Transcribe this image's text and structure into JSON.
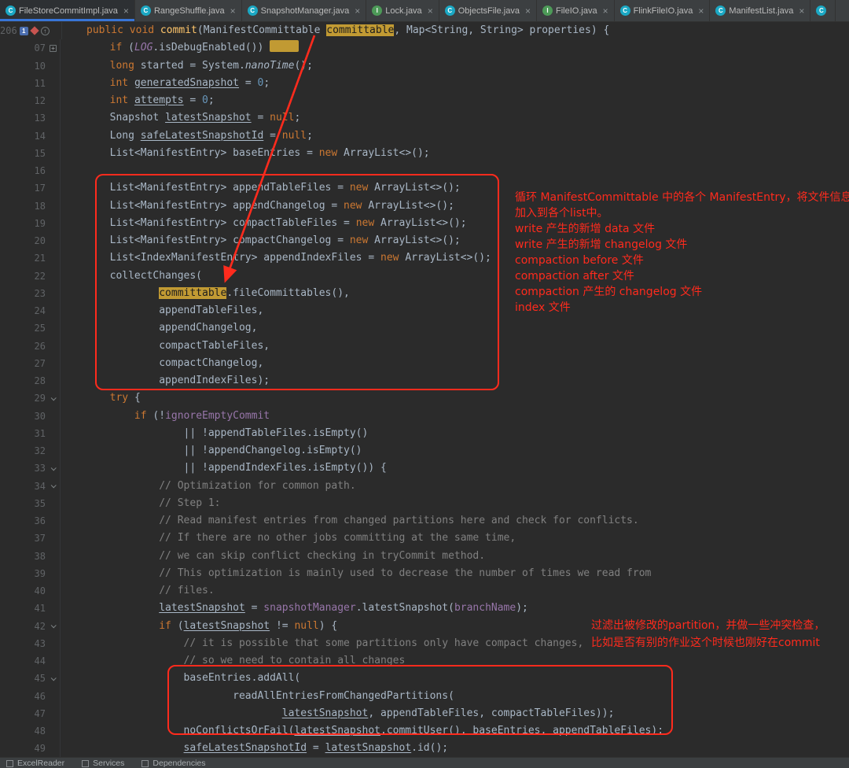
{
  "theme": {
    "bg": "#2b2b2b",
    "fg": "#a9b7c6",
    "kw": "#cc7832",
    "num": "#6897bb",
    "cmt": "#808080",
    "field": "#9876aa",
    "method": "#ffc66b",
    "gold": "#c19a33",
    "goldfg": "#1d1d1d",
    "red": "#ff2b1d",
    "gutterfg": "#606366",
    "tabbar": "#3c3f41",
    "tabactive": "#2d3033",
    "underline": "#3875d7",
    "classicon": "#1ba8c4",
    "interfaceicon": "#4d9a58",
    "statusbar": "#3c3f41",
    "border": "#323232"
  },
  "tab_bar": {
    "close_glyph": "×",
    "tabs": [
      {
        "label": "FileStoreCommitImpl.java",
        "icon": "class",
        "active": true
      },
      {
        "label": "RangeShuffle.java",
        "icon": "class",
        "active": false
      },
      {
        "label": "SnapshotManager.java",
        "icon": "class",
        "active": false
      },
      {
        "label": "Lock.java",
        "icon": "interface",
        "active": false
      },
      {
        "label": "ObjectsFile.java",
        "icon": "class",
        "active": false
      },
      {
        "label": "FileIO.java",
        "icon": "interface",
        "active": false
      },
      {
        "label": "FlinkFileIO.java",
        "icon": "class",
        "active": false
      },
      {
        "label": "ManifestList.java",
        "icon": "class",
        "active": false
      },
      {
        "label": "",
        "icon": "class",
        "active": false,
        "clipped": true
      }
    ]
  },
  "editor": {
    "lines": [
      {
        "num": "206",
        "marks": [
          "bm",
          "dm",
          "ov"
        ],
        "seg": [
          [
            "    ",
            "d"
          ],
          [
            "public void ",
            "k"
          ],
          [
            "commit",
            "m"
          ],
          [
            "(ManifestCommittable ",
            "d"
          ],
          [
            "committable",
            "h"
          ],
          [
            ", Map<String, String> properties) {",
            "d"
          ]
        ]
      },
      {
        "num": "07",
        "fold": "+",
        "seg": [
          [
            "        ",
            "d"
          ],
          [
            "if ",
            "k"
          ],
          [
            "(",
            "d"
          ],
          [
            "LOG",
            "s"
          ],
          [
            ".isDebugEnabled()) ",
            "d"
          ],
          [
            "",
            "fb"
          ]
        ]
      },
      {
        "num": "10",
        "seg": [
          [
            "        ",
            "d"
          ],
          [
            "long ",
            "k"
          ],
          [
            "started = System.",
            "d"
          ],
          [
            "nanoTime",
            "i"
          ],
          [
            "();",
            "d"
          ]
        ]
      },
      {
        "num": "11",
        "seg": [
          [
            "        ",
            "d"
          ],
          [
            "int ",
            "k"
          ],
          [
            "generatedSnapshot",
            "u"
          ],
          [
            " = ",
            "d"
          ],
          [
            "0",
            "n"
          ],
          [
            ";",
            "d"
          ]
        ]
      },
      {
        "num": "12",
        "seg": [
          [
            "        ",
            "d"
          ],
          [
            "int ",
            "k"
          ],
          [
            "attempts",
            "u"
          ],
          [
            " = ",
            "d"
          ],
          [
            "0",
            "n"
          ],
          [
            ";",
            "d"
          ]
        ]
      },
      {
        "num": "13",
        "seg": [
          [
            "        Snapshot ",
            "d"
          ],
          [
            "latestSnapshot",
            "u"
          ],
          [
            " = ",
            "d"
          ],
          [
            "null",
            "k"
          ],
          [
            ";",
            "d"
          ]
        ]
      },
      {
        "num": "14",
        "seg": [
          [
            "        Long ",
            "d"
          ],
          [
            "safeLatestSnapshotId",
            "u"
          ],
          [
            " = ",
            "d"
          ],
          [
            "null",
            "k"
          ],
          [
            ";",
            "d"
          ]
        ]
      },
      {
        "num": "15",
        "seg": [
          [
            "        List<ManifestEntry> baseEntries = ",
            "d"
          ],
          [
            "new ",
            "k"
          ],
          [
            "ArrayList<>();",
            "d"
          ]
        ]
      },
      {
        "num": "16",
        "seg": []
      },
      {
        "num": "17",
        "seg": [
          [
            "        List<ManifestEntry> appendTableFiles = ",
            "d"
          ],
          [
            "new ",
            "k"
          ],
          [
            "ArrayList<>();",
            "d"
          ]
        ]
      },
      {
        "num": "18",
        "seg": [
          [
            "        List<ManifestEntry> appendChangelog = ",
            "d"
          ],
          [
            "new ",
            "k"
          ],
          [
            "ArrayList<>();",
            "d"
          ]
        ]
      },
      {
        "num": "19",
        "seg": [
          [
            "        List<ManifestEntry> compactTableFiles = ",
            "d"
          ],
          [
            "new ",
            "k"
          ],
          [
            "ArrayList<>();",
            "d"
          ]
        ]
      },
      {
        "num": "20",
        "seg": [
          [
            "        List<ManifestEntry> compactChangelog = ",
            "d"
          ],
          [
            "new ",
            "k"
          ],
          [
            "ArrayList<>();",
            "d"
          ]
        ]
      },
      {
        "num": "21",
        "seg": [
          [
            "        List<IndexManifestEntry> appendIndexFiles = ",
            "d"
          ],
          [
            "new ",
            "k"
          ],
          [
            "ArrayList<>();",
            "d"
          ]
        ]
      },
      {
        "num": "22",
        "seg": [
          [
            "        collectChanges(",
            "d"
          ]
        ]
      },
      {
        "num": "23",
        "seg": [
          [
            "                ",
            "d"
          ],
          [
            "committable",
            "h"
          ],
          [
            ".fileCommittables(),",
            "d"
          ]
        ]
      },
      {
        "num": "24",
        "seg": [
          [
            "                appendTableFiles,",
            "d"
          ]
        ]
      },
      {
        "num": "25",
        "seg": [
          [
            "                appendChangelog,",
            "d"
          ]
        ]
      },
      {
        "num": "26",
        "seg": [
          [
            "                compactTableFiles,",
            "d"
          ]
        ]
      },
      {
        "num": "27",
        "seg": [
          [
            "                compactChangelog,",
            "d"
          ]
        ]
      },
      {
        "num": "28",
        "seg": [
          [
            "                appendIndexFiles);",
            "d"
          ]
        ]
      },
      {
        "num": "29",
        "fold": "v",
        "seg": [
          [
            "        ",
            "d"
          ],
          [
            "try ",
            "k"
          ],
          [
            "{",
            "d"
          ]
        ]
      },
      {
        "num": "30",
        "seg": [
          [
            "            ",
            "d"
          ],
          [
            "if ",
            "k"
          ],
          [
            "(!",
            "d"
          ],
          [
            "ignoreEmptyCommit",
            "f"
          ]
        ]
      },
      {
        "num": "31",
        "seg": [
          [
            "                    || !appendTableFiles.isEmpty()",
            "d"
          ]
        ]
      },
      {
        "num": "32",
        "seg": [
          [
            "                    || !appendChangelog.isEmpty()",
            "d"
          ]
        ]
      },
      {
        "num": "33",
        "fold": "v",
        "seg": [
          [
            "                    || !appendIndexFiles.isEmpty()) {",
            "d"
          ]
        ]
      },
      {
        "num": "34",
        "fold": "v",
        "seg": [
          [
            "                ",
            "d"
          ],
          [
            "// Optimization for common path.",
            "c"
          ]
        ]
      },
      {
        "num": "35",
        "seg": [
          [
            "                ",
            "d"
          ],
          [
            "// Step 1:",
            "c"
          ]
        ]
      },
      {
        "num": "36",
        "seg": [
          [
            "                ",
            "d"
          ],
          [
            "// Read manifest entries from changed partitions here and check for conflicts.",
            "c"
          ]
        ]
      },
      {
        "num": "37",
        "seg": [
          [
            "                ",
            "d"
          ],
          [
            "// If there are no other jobs committing at the same time,",
            "c"
          ]
        ]
      },
      {
        "num": "38",
        "seg": [
          [
            "                ",
            "d"
          ],
          [
            "// we can skip conflict checking in tryCommit method.",
            "c"
          ]
        ]
      },
      {
        "num": "39",
        "seg": [
          [
            "                ",
            "d"
          ],
          [
            "// This optimization is mainly used to decrease the number of times we read from",
            "c"
          ]
        ]
      },
      {
        "num": "40",
        "seg": [
          [
            "                ",
            "d"
          ],
          [
            "// files.",
            "c"
          ]
        ]
      },
      {
        "num": "41",
        "seg": [
          [
            "                ",
            "d"
          ],
          [
            "latestSnapshot",
            "u"
          ],
          [
            " = ",
            "d"
          ],
          [
            "snapshotManager",
            "f"
          ],
          [
            ".latestSnapshot(",
            "d"
          ],
          [
            "branchName",
            "f"
          ],
          [
            ");",
            "d"
          ]
        ]
      },
      {
        "num": "42",
        "fold": "v",
        "seg": [
          [
            "                ",
            "d"
          ],
          [
            "if ",
            "k"
          ],
          [
            "(",
            "d"
          ],
          [
            "latestSnapshot",
            "u"
          ],
          [
            " != ",
            "d"
          ],
          [
            "null",
            "k"
          ],
          [
            ") {",
            "d"
          ]
        ]
      },
      {
        "num": "43",
        "seg": [
          [
            "                    ",
            "d"
          ],
          [
            "// it is possible that some partitions only have compact changes,",
            "c"
          ]
        ]
      },
      {
        "num": "44",
        "seg": [
          [
            "                    ",
            "d"
          ],
          [
            "// so we need to contain all changes",
            "c"
          ]
        ]
      },
      {
        "num": "45",
        "fold": "v",
        "seg": [
          [
            "                    baseEntries.addAll(",
            "d"
          ]
        ]
      },
      {
        "num": "46",
        "seg": [
          [
            "                            readAllEntriesFromChangedPartitions(",
            "d"
          ]
        ]
      },
      {
        "num": "47",
        "seg": [
          [
            "                                    ",
            "d"
          ],
          [
            "latestSnapshot",
            "u"
          ],
          [
            ", appendTableFiles, compactTableFiles));",
            "d"
          ]
        ]
      },
      {
        "num": "48",
        "seg": [
          [
            "                    noConflictsOrFail(",
            "d"
          ],
          [
            "latestSnapshot",
            "u"
          ],
          [
            ".commitUser(), baseEntries, appendTableFiles);",
            "d"
          ]
        ]
      },
      {
        "num": "49",
        "seg": [
          [
            "                    ",
            "d"
          ],
          [
            "safeLatestSnapshotId",
            "u"
          ],
          [
            " = ",
            "d"
          ],
          [
            "latestSnapshot",
            "u"
          ],
          [
            ".id();",
            "d"
          ]
        ]
      }
    ]
  },
  "overlay": {
    "note_collect_lines": [
      "循环 ManifestCommittable 中的各个 ManifestEntry，将文件信息",
      "加入到各个list中。",
      "write 产生的新增 data 文件",
      "write 产生的新增 changelog 文件",
      "compaction before 文件",
      "compaction after 文件",
      "compaction 产生的 changelog 文件",
      "index 文件"
    ],
    "note_conflict_lines": [
      "过滤出被修改的partition，并做一些冲突检查，",
      "比如是否有别的作业这个时候也刚好在commit"
    ]
  },
  "status_bar": {
    "items": [
      {
        "label": "ExcelReader",
        "icon": "run-window-icon"
      },
      {
        "label": "Services",
        "icon": "services-icon"
      },
      {
        "label": "Dependencies",
        "icon": "dependencies-icon"
      }
    ]
  }
}
